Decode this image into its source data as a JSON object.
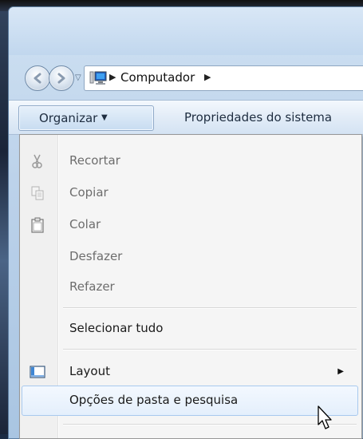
{
  "address_bar": {
    "location": "Computador"
  },
  "toolbar": {
    "organize_label": "Organizar",
    "properties_label": "Propriedades do sistema"
  },
  "menu": {
    "items": [
      {
        "label": "Recortar",
        "icon": "scissors-icon",
        "enabled": false
      },
      {
        "label": "Copiar",
        "icon": "copy-icon",
        "enabled": false
      },
      {
        "label": "Colar",
        "icon": "paste-icon",
        "enabled": true
      },
      {
        "label": "Desfazer",
        "icon": "",
        "enabled": false
      },
      {
        "label": "Refazer",
        "icon": "",
        "enabled": false
      },
      {
        "label": "Selecionar tudo",
        "icon": "",
        "enabled": true
      },
      {
        "label": "Layout",
        "icon": "layout-icon",
        "enabled": true,
        "submenu": true
      },
      {
        "label": "Opções de pasta e pesquisa",
        "icon": "",
        "enabled": true,
        "highlighted": true
      }
    ]
  },
  "colors": {
    "highlight_border": "#a8c9ee",
    "toolbar_text": "#1e2d40",
    "disabled_text": "#6d6d6d"
  }
}
